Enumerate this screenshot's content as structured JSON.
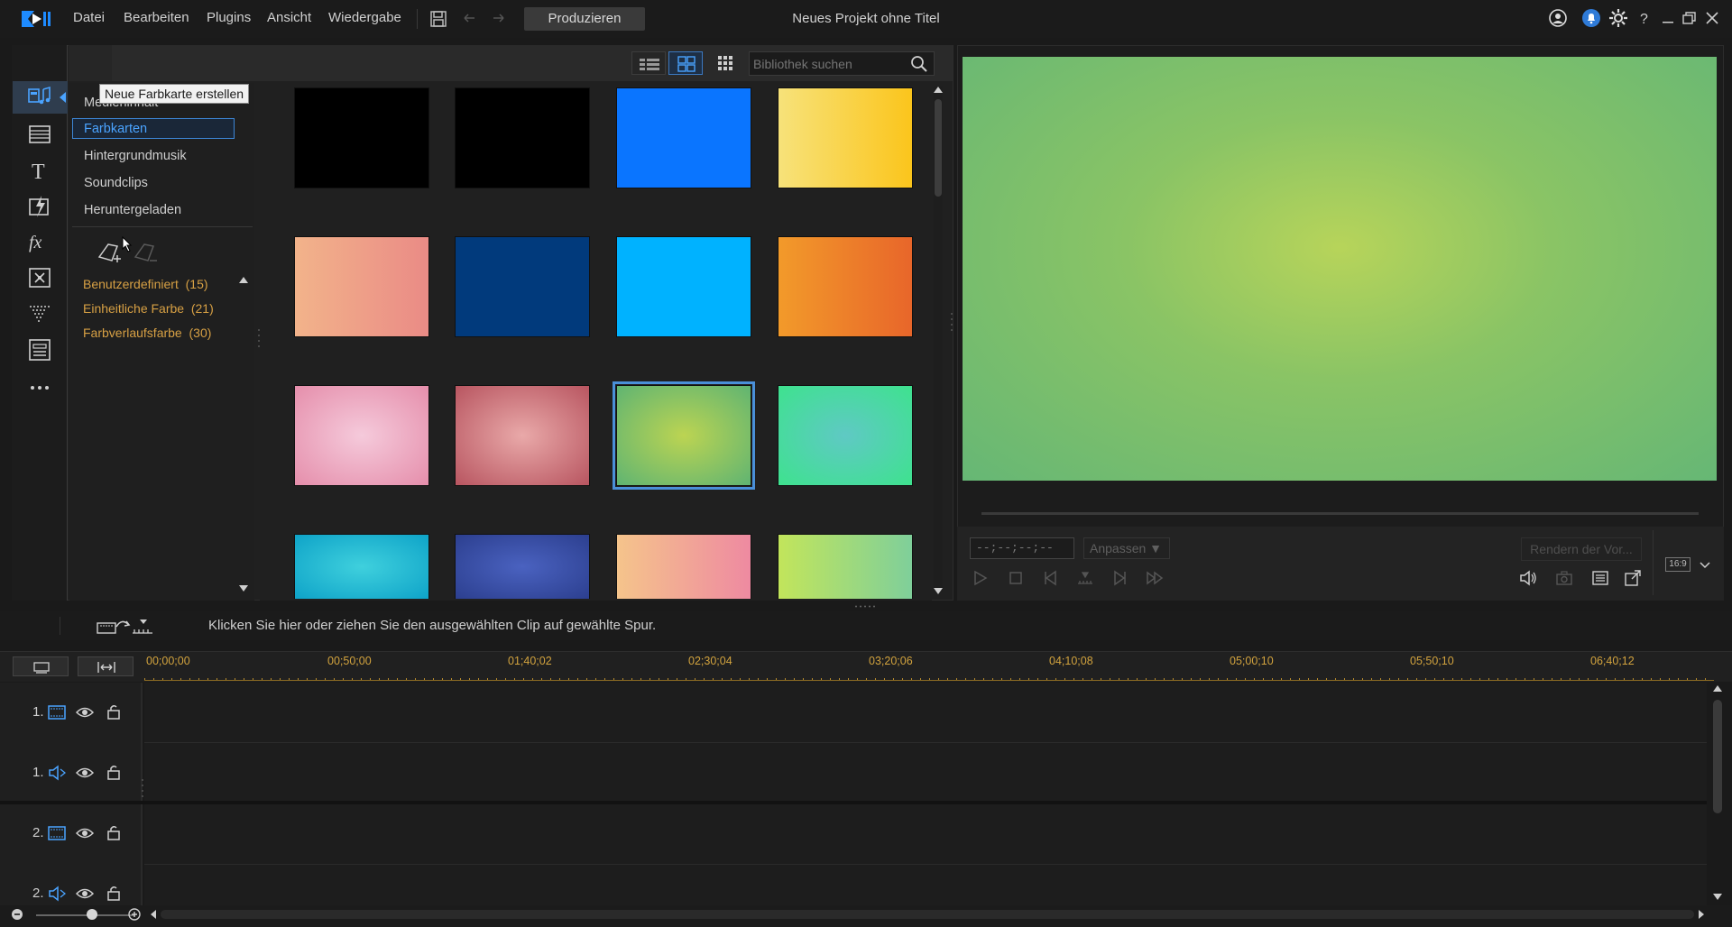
{
  "app": {
    "project_title": "Neues Projekt ohne Titel",
    "produce_label": "Produzieren",
    "accent": "#3d86d6"
  },
  "menu": [
    "Datei",
    "Bearbeiten",
    "Plugins",
    "Ansicht",
    "Wiedergabe"
  ],
  "room_icons": [
    "media-room-icon",
    "transitions-room-icon",
    "title-room-icon",
    "effects-room-icon",
    "fx-room-icon",
    "pip-room-icon",
    "particle-room-icon",
    "subtitle-room-icon",
    "more-icon"
  ],
  "tooltip": "Neue Farbkarte erstellen",
  "library": {
    "categories": [
      "Medieninhalt",
      "Farbkarten",
      "Hintergrundmusik",
      "Soundclips",
      "Heruntergeladen"
    ],
    "selected_category": "Farbkarten",
    "tags": [
      {
        "label": "Benutzerdefiniert",
        "count": "(15)"
      },
      {
        "label": "Einheitliche Farbe",
        "count": "(21)"
      },
      {
        "label": "Farbverlaufsfarbe",
        "count": "(30)"
      }
    ],
    "search_placeholder": "Bibliothek suchen",
    "thumbnails": [
      {
        "color": "#000000"
      },
      {
        "color": "#000000"
      },
      {
        "color": "#0a75ff"
      },
      {
        "color": "linear-gradient(90deg,#f7e27a,#fbc51c)"
      },
      {
        "color": "linear-gradient(90deg,#f2b38a,#ea8b86)"
      },
      {
        "color": "#013a7c"
      },
      {
        "color": "#00b2ff"
      },
      {
        "color": "linear-gradient(90deg,#f29a2a,#e8662a)"
      },
      {
        "color": "radial-gradient(ellipse at center,#f5cadb,#e58eab)"
      },
      {
        "color": "radial-gradient(ellipse at center,#e9a9a9,#b85560)"
      },
      {
        "color": "radial-gradient(ellipse at center,#bcd452,#5fb472)",
        "selected": true
      },
      {
        "color": "radial-gradient(ellipse at center,#5fc9c4,#3ee28e)"
      },
      {
        "color": "radial-gradient(ellipse at center,#3fd0dd,#0ea3c8)"
      },
      {
        "color": "radial-gradient(ellipse at center,#4a62c0,#2c3f8f)"
      },
      {
        "color": "linear-gradient(90deg,#f5c48b,#ee8aa1)"
      },
      {
        "color": "linear-gradient(90deg,#c2e55b,#7fcf9a)"
      }
    ]
  },
  "preview": {
    "timecode": "--;--;--;--",
    "fit_label": "Anpassen ▼",
    "render_label": "Rendern der Vor...",
    "aspect": "16:9"
  },
  "timeline": {
    "hint": "Klicken Sie hier oder ziehen Sie den ausgewählten Clip auf gewählte Spur.",
    "ruler": [
      "00;00;00",
      "00;50;00",
      "01;40;02",
      "02;30;04",
      "03;20;06",
      "04;10;08",
      "05;00;10",
      "05;50;10",
      "06;40;12"
    ],
    "tracks": [
      {
        "num": "1.",
        "type": "video"
      },
      {
        "num": "1.",
        "type": "audio"
      },
      {
        "num": "2.",
        "type": "video"
      },
      {
        "num": "2.",
        "type": "audio"
      }
    ]
  }
}
